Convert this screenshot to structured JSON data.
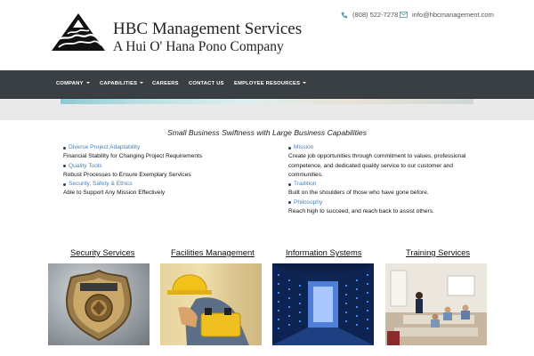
{
  "header": {
    "title": "HBC Management Services",
    "subtitle": "A Hui O' Hana Pono Company",
    "phone": "(808) 522-7278",
    "email": "info@hbcmanagement.com",
    "logo_icon": "mountain-wave-logo-icon",
    "phone_icon": "phone-icon",
    "email_icon": "envelope-icon"
  },
  "nav": {
    "items": [
      {
        "label": "COMPANY",
        "dropdown": true
      },
      {
        "label": "CAPABILITIES",
        "dropdown": true
      },
      {
        "label": "CAREERS",
        "dropdown": false
      },
      {
        "label": "CONTACT US",
        "dropdown": false
      },
      {
        "label": "EMPLOYEE RESOURCES",
        "dropdown": true
      }
    ]
  },
  "tagline": "Small Business Swiftness with Large Business Capabilities",
  "features": {
    "left": [
      {
        "title": "Diverse Project Adaptability",
        "desc": "Financial Stability for Changing Project Requirements"
      },
      {
        "title": "Quality Tools",
        "desc": "Robust Processes to Ensure Exemplary Services"
      },
      {
        "title": "Security, Safety & Ethics",
        "desc": "Able to Support Any Mission Effectively"
      }
    ],
    "right": [
      {
        "title": "Mission",
        "desc": "Create job opportunities through commitment to values, professional competence, and dedicated quality service to our customer and communities."
      },
      {
        "title": "Tradition",
        "desc": "Built on the shoulders of those who have gone before."
      },
      {
        "title": "Philosophy",
        "desc": "Reach high to succeed, and reach back to assist others."
      }
    ]
  },
  "services": [
    {
      "label": "Security Services",
      "image": "security-badge-photo"
    },
    {
      "label": "Facilities Management",
      "image": "worker-hardhat-photo"
    },
    {
      "label": "Information Systems",
      "image": "server-room-photo"
    },
    {
      "label": "Training Services",
      "image": "classroom-photo"
    }
  ],
  "colors": {
    "nav_bg": "#3a3f44",
    "link_blue": "#4a7fb0",
    "text": "#222222"
  }
}
